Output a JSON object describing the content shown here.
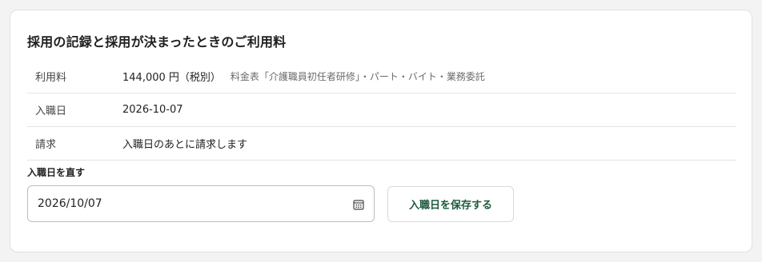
{
  "card": {
    "title": "採用の記録と採用が決まったときのご利用料"
  },
  "details": {
    "rows": [
      {
        "label": "利用料",
        "value": "144,000 円（税別）",
        "note": "料金表「介護職員初任者研修」・パート・バイト・業務委託"
      },
      {
        "label": "入職日",
        "value": "2026-10-07"
      },
      {
        "label": "請求",
        "value": "入職日のあとに請求します"
      }
    ]
  },
  "edit": {
    "label": "入職日を直す",
    "date_value": "2026/10/07",
    "save_label": "入職日を保存する",
    "icon": "calendar-icon"
  },
  "colors": {
    "accent": "#1d5b3c",
    "background": "#f3f3f3",
    "card": "#ffffff",
    "divider": "#e4e4e4"
  }
}
